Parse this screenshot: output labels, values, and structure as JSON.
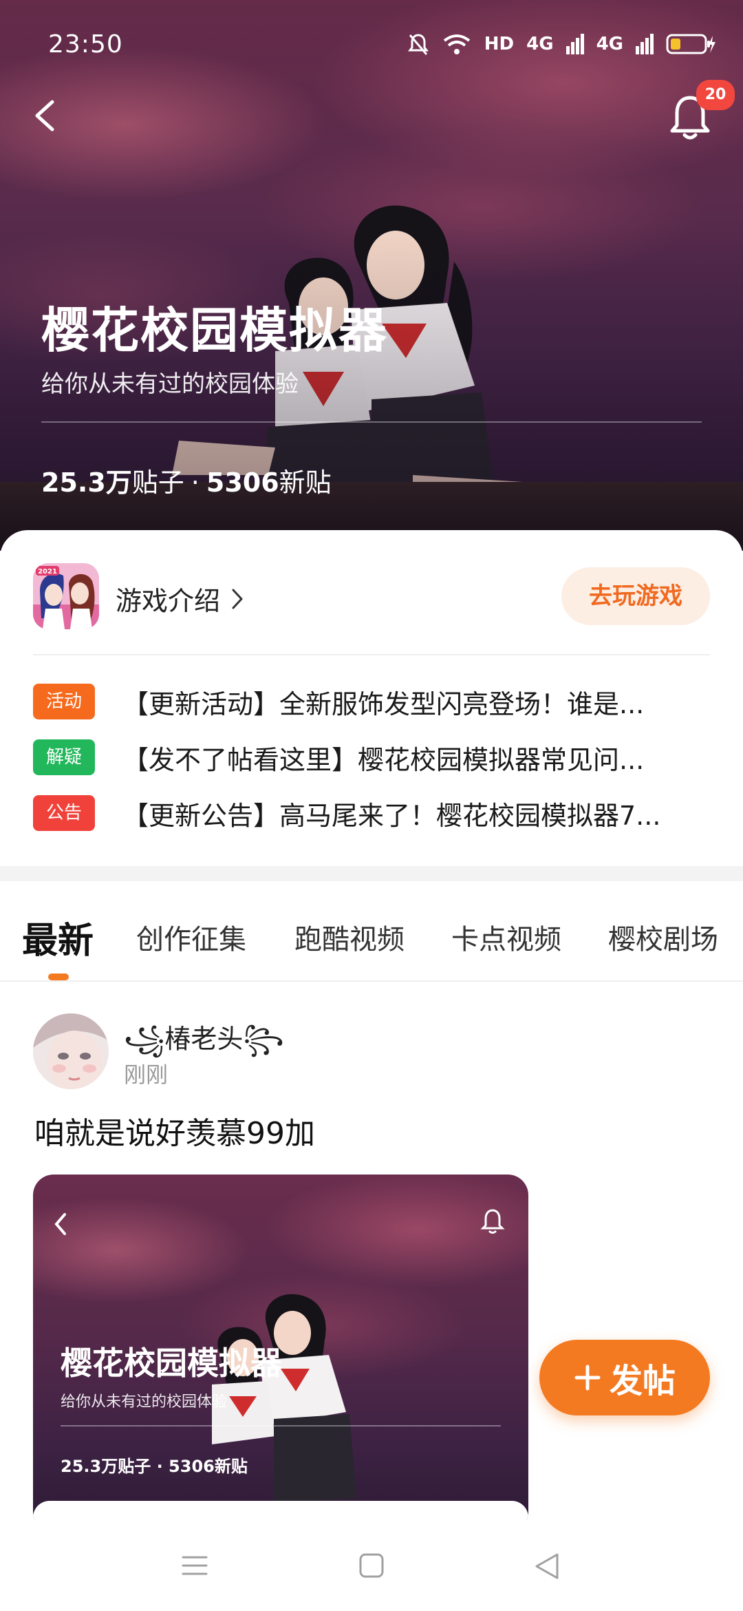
{
  "status": {
    "time": "23:50",
    "network1": "4G",
    "network2": "4G",
    "hd_label": "HD"
  },
  "header": {
    "notification_count": "20"
  },
  "forum": {
    "title": "樱花校园模拟器",
    "subtitle": "给你从未有过的校园体验",
    "posts_count": "25.3万",
    "posts_label": "贴子",
    "separator": "·",
    "new_posts_count": "5306",
    "new_posts_label": "新贴"
  },
  "game": {
    "intro_label": "游戏介绍",
    "play_button": "去玩游戏",
    "icon_badge": "2021"
  },
  "notices": [
    {
      "tag": "活动",
      "tag_color": "#f66a1e",
      "text": "【更新活动】全新服饰发型闪亮登场！谁是..."
    },
    {
      "tag": "解疑",
      "tag_color": "#22b75b",
      "text": "【发不了帖看这里】樱花校园模拟器常见问..."
    },
    {
      "tag": "公告",
      "tag_color": "#f0423a",
      "text": "【更新公告】高马尾来了！樱花校园模拟器7..."
    }
  ],
  "tabs": [
    {
      "label": "最新",
      "active": true
    },
    {
      "label": "创作征集",
      "active": false
    },
    {
      "label": "跑酷视频",
      "active": false
    },
    {
      "label": "卡点视频",
      "active": false
    },
    {
      "label": "樱校剧场",
      "active": false
    }
  ],
  "post": {
    "username": "꧁椿老头꧂",
    "time": "刚刚",
    "text": "咱就是说好羡慕99加",
    "thumbnail": {
      "title": "樱花校园模拟器",
      "subtitle": "给你从未有过的校园体验",
      "stats": "25.3万贴子 · 5306新贴"
    }
  },
  "fab": {
    "label": "发帖"
  },
  "colors": {
    "accent": "#f47a22",
    "play_bg": "#fdeee4",
    "play_text": "#f06a20"
  }
}
